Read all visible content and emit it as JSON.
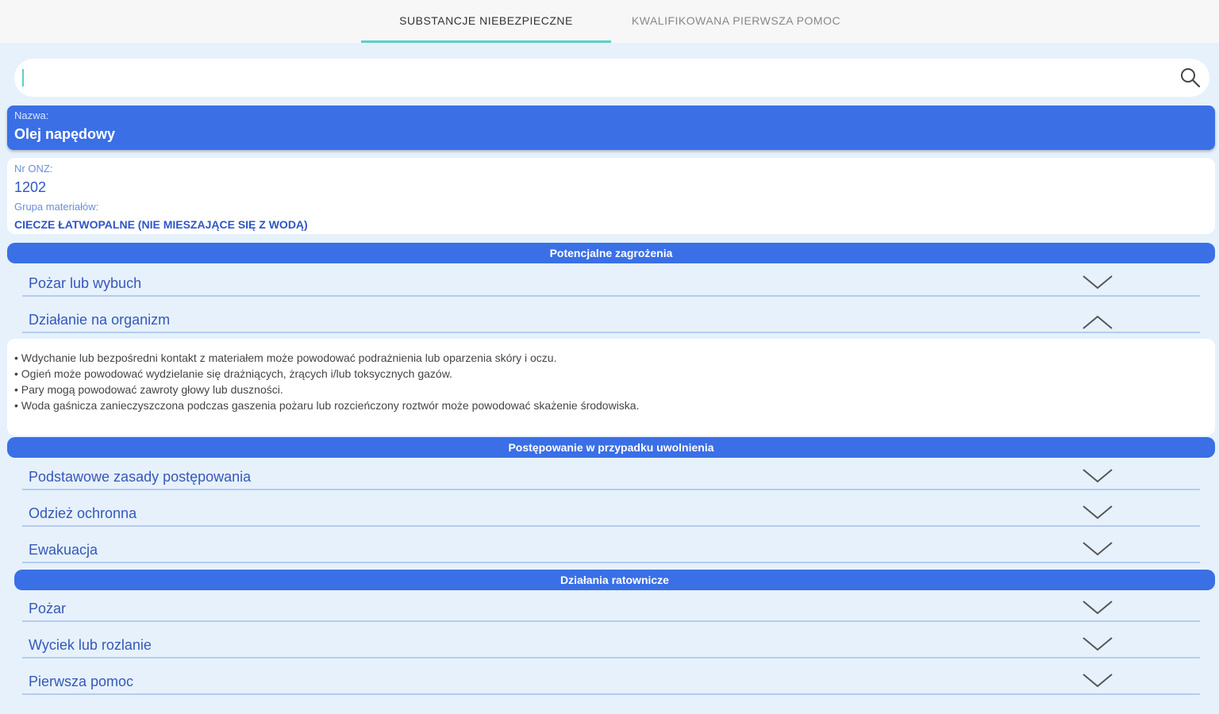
{
  "tabs": [
    {
      "label": "SUBSTANCJE NIEBEZPIECZNE",
      "active": true
    },
    {
      "label": "KWALIFIKOWANA PIERWSZA POMOC",
      "active": false
    }
  ],
  "search": {
    "value": "",
    "placeholder": ""
  },
  "substance": {
    "name_label": "Nazwa:",
    "name": "Olej napędowy",
    "un_label": "Nr ONZ:",
    "un_number": "1202",
    "group_label": "Grupa materiałów:",
    "group": "CIECZE ŁATWOPALNE (NIE MIESZAJĄCE SIĘ Z WODĄ)"
  },
  "sections": [
    {
      "title": "Potencjalne zagrożenia",
      "items": [
        {
          "label": "Pożar lub wybuch",
          "expanded": false
        },
        {
          "label": "Działanie na organizm",
          "expanded": true
        }
      ]
    },
    {
      "title": "Postępowanie w przypadku uwolnienia",
      "items": [
        {
          "label": "Podstawowe zasady postępowania",
          "expanded": false
        },
        {
          "label": "Odzież ochronna",
          "expanded": false
        },
        {
          "label": "Ewakuacja",
          "expanded": false
        }
      ]
    },
    {
      "title": "Działania ratownicze",
      "items": [
        {
          "label": "Pożar",
          "expanded": false
        },
        {
          "label": "Wyciek lub rozlanie",
          "expanded": false
        },
        {
          "label": "Pierwsza pomoc",
          "expanded": false
        }
      ]
    }
  ],
  "details": [
    "• Wdychanie lub bezpośredni kontakt z materiałem może powodować podrażnienia lub oparzenia skóry i oczu.",
    "• Ogień może powodować wydzielanie się drażniących, żrących i/lub toksycznych gazów.",
    "• Pary mogą powodować zawroty głowy lub duszności.",
    "• Woda gaśnicza zanieczyszczona podczas gaszenia pożaru lub rozcieńczony roztwór może powodować skażenie środowiska."
  ],
  "colors": {
    "accent": "#3a6fe6",
    "tab_indicator": "#5fcfc4",
    "background": "#e6f1fc"
  },
  "icons": {
    "search": "search-icon",
    "collapsed": "chevron-down-icon",
    "expanded": "chevron-up-icon"
  }
}
